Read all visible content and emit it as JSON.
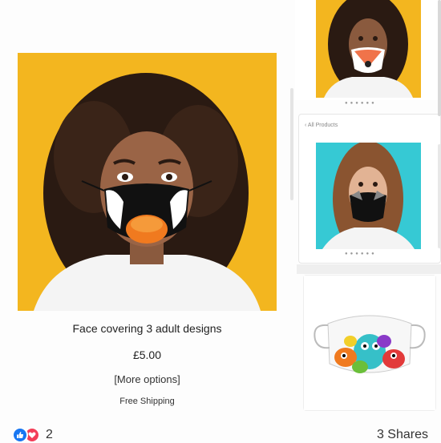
{
  "product": {
    "title": "Face covering 3 adult designs",
    "price": "£5.00",
    "options": "[More options]",
    "shipping": "Free Shipping"
  },
  "right_panel": {
    "back_link": "All Products"
  },
  "footer": {
    "reaction_count": "2",
    "shares": "3 Shares"
  },
  "colors": {
    "yellow_bg": "#f3b61f",
    "teal_bg": "#36c9d4",
    "like_blue": "#1877f2",
    "love_red": "#f33e58"
  }
}
